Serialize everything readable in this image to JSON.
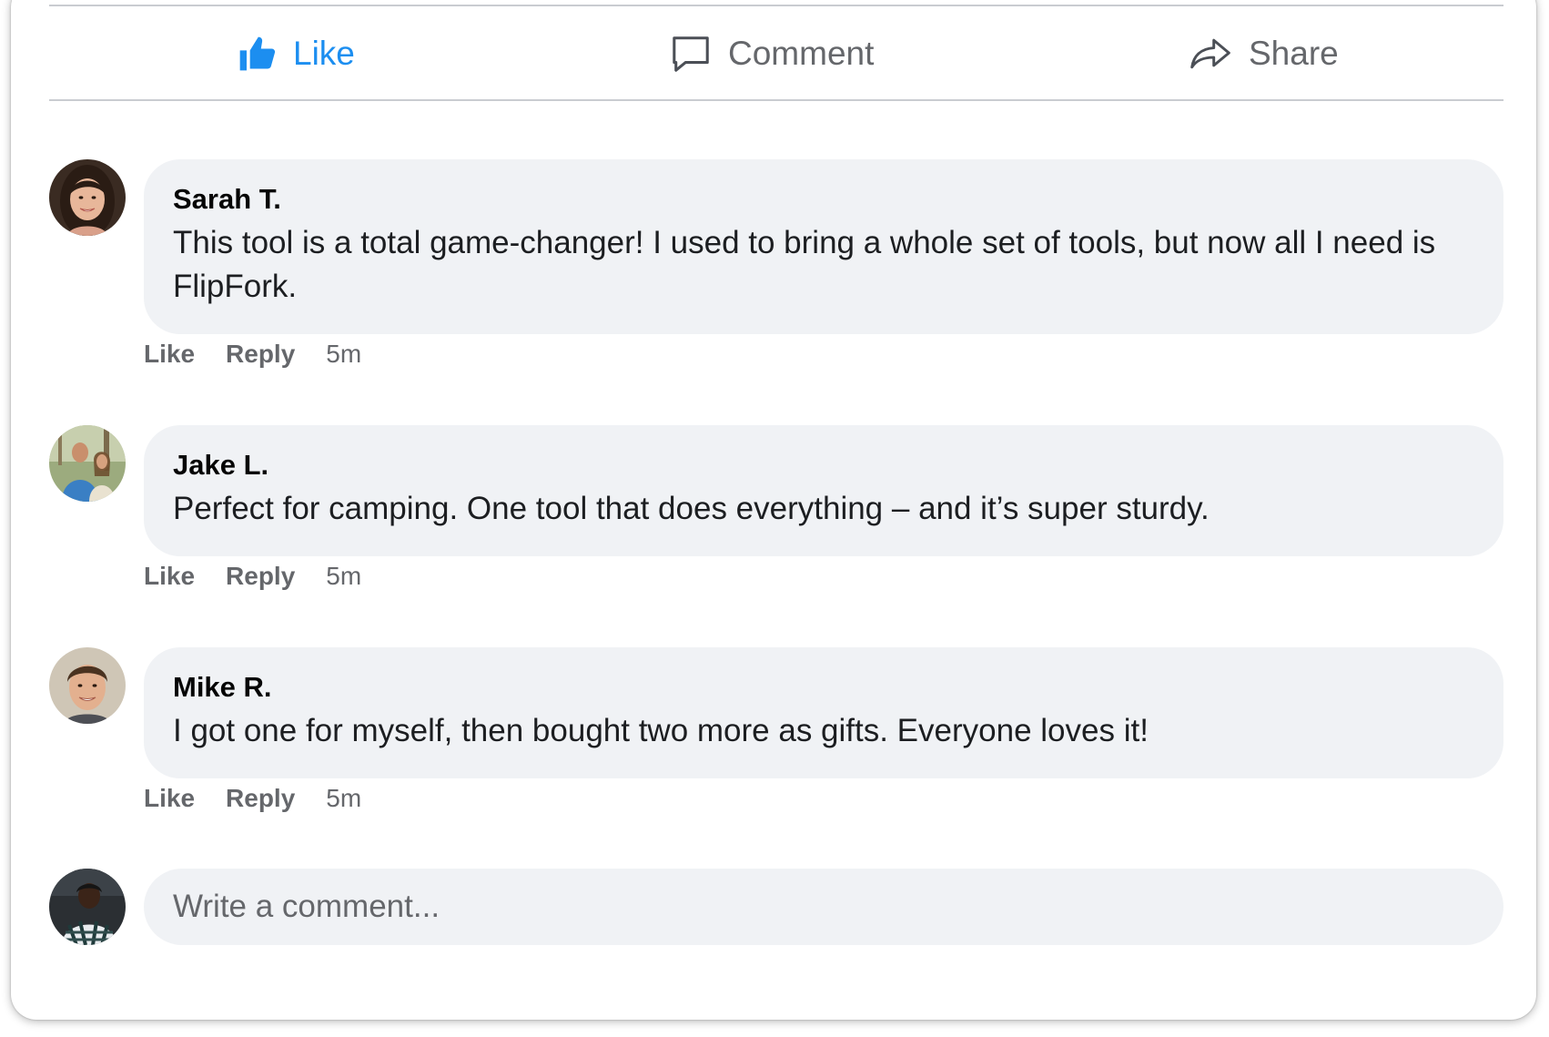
{
  "actions": {
    "like_label": "Like",
    "comment_label": "Comment",
    "share_label": "Share",
    "like_color": "#1c8ef0",
    "muted_color": "#65676b"
  },
  "comments": [
    {
      "author": "Sarah T.",
      "text": "This tool is a total game-changer! I used to bring a whole set of tools, but now all I need is FlipFork.",
      "like_label": "Like",
      "reply_label": "Reply",
      "time": "5m"
    },
    {
      "author": "Jake L.",
      "text": "Perfect for camping. One tool that does everything – and it’s super sturdy.",
      "like_label": "Like",
      "reply_label": "Reply",
      "time": "5m"
    },
    {
      "author": "Mike R.",
      "text": "I got one for myself, then bought two more as gifts. Everyone loves it!",
      "like_label": "Like",
      "reply_label": "Reply",
      "time": "5m"
    }
  ],
  "composer": {
    "placeholder": "Write a comment..."
  },
  "colors": {
    "bubble": "#f0f2f5",
    "divider": "#c9ccd1"
  }
}
